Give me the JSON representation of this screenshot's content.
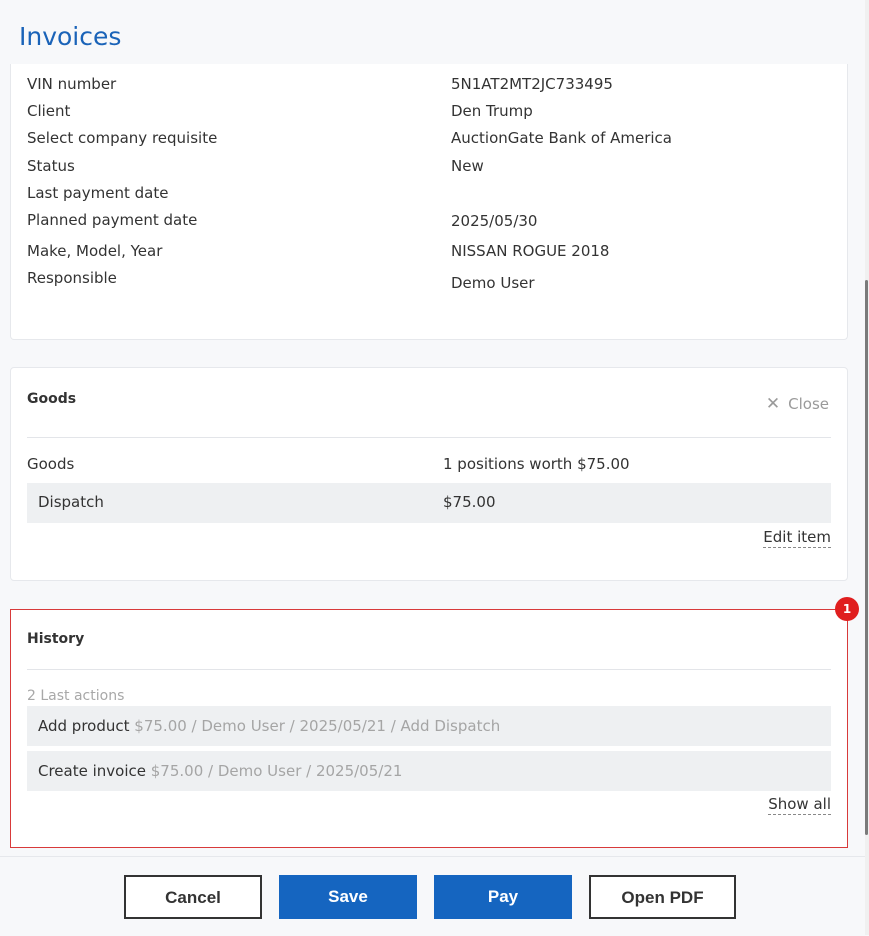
{
  "page": {
    "title": "Invoices"
  },
  "details": {
    "rows": [
      {
        "label": "VIN number",
        "value": "5N1AT2MT2JC733495"
      },
      {
        "label": "Client",
        "value": "Den Trump"
      },
      {
        "label": "Select company requisite",
        "value": "AuctionGate Bank of America"
      },
      {
        "label": "Status",
        "value": "New"
      },
      {
        "label": "Last payment date",
        "value": ""
      },
      {
        "label": "Planned payment date",
        "value": "2025/05/30"
      },
      {
        "label": "Make, Model, Year",
        "value": "NISSAN ROGUE 2018"
      },
      {
        "label": "Responsible",
        "value": "Demo User"
      }
    ]
  },
  "goods": {
    "title": "Goods",
    "close_label": "Close",
    "summary_label": "Goods",
    "summary_value": "1 positions worth $75.00",
    "items": [
      {
        "name": "Dispatch",
        "price": "$75.00"
      }
    ],
    "edit_label": "Edit item"
  },
  "history": {
    "title": "History",
    "count_label": "2 Last actions",
    "items": [
      {
        "action": "Add product",
        "details": "$75.00 / Demo User / 2025/05/21 / Add Dispatch"
      },
      {
        "action": "Create invoice",
        "details": "$75.00 / Demo User / 2025/05/21"
      }
    ],
    "show_all_label": "Show all",
    "badge": "1"
  },
  "footer": {
    "cancel_label": "Cancel",
    "save_label": "Save",
    "pay_label": "Pay",
    "open_pdf_label": "Open PDF"
  },
  "colors": {
    "accent": "#1565c0",
    "title": "#1a63b8",
    "highlight_border": "#d83a3a",
    "badge": "#e01e1e"
  },
  "icons": {
    "close": "close-icon"
  }
}
